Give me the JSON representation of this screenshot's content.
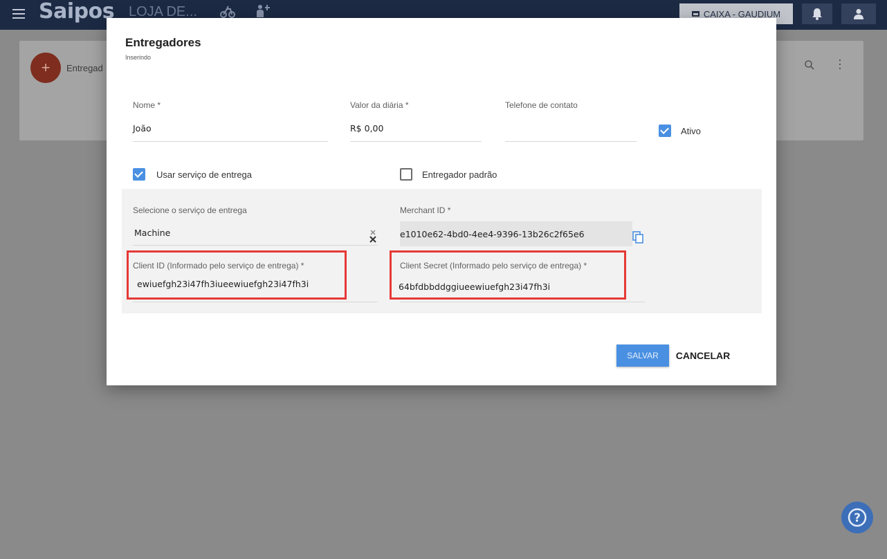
{
  "topbar": {
    "logo": "Saipos",
    "store_name": "LOJA DE...",
    "caixa_label": "CAIXA - GAUDIUM",
    "menu_icon": "menu-icon",
    "bike_icon": "delivery-bike-icon",
    "people_icon": "waiter-icon",
    "bell_icon": "bell-icon",
    "user_icon": "user-icon"
  },
  "background": {
    "add_button_label": "+",
    "title": "Entregad"
  },
  "modal": {
    "title": "Entregadores",
    "subtitle": "Inserindo",
    "fields": {
      "nome_label": "Nome *",
      "nome_value": "João",
      "diaria_label": "Valor da diária *",
      "diaria_value": "R$ 0,00",
      "telefone_label": "Telefone de contato",
      "telefone_value": "",
      "ativo_label": "Ativo",
      "ativo_checked": true
    },
    "options": {
      "usar_servico_label": "Usar serviço de entrega",
      "usar_servico_checked": true,
      "padrao_label": "Entregador padrão",
      "padrao_checked": false
    },
    "service": {
      "select_label": "Selecione o serviço de entrega",
      "select_value": "Machine",
      "merchant_label": "Merchant ID *",
      "merchant_value": "e1010e62-4bd0-4ee4-9396-13b26c2f65e6",
      "client_id_label": "Client ID (Informado pelo serviço de entrega) *",
      "client_id_value": "ewiuefgh23i47fh3iueewiuefgh23i47fh3i",
      "client_secret_label": "Client Secret (Informado pelo serviço de entrega) *",
      "client_secret_value": "64bfdbbddggiueewiuefgh23i47fh3i"
    },
    "buttons": {
      "save": "SALVAR",
      "cancel": "CANCELAR"
    }
  },
  "help_label": "?",
  "colors": {
    "topbar": "#1c2a44",
    "accent": "#4a90e2",
    "highlight": "#e53935"
  }
}
